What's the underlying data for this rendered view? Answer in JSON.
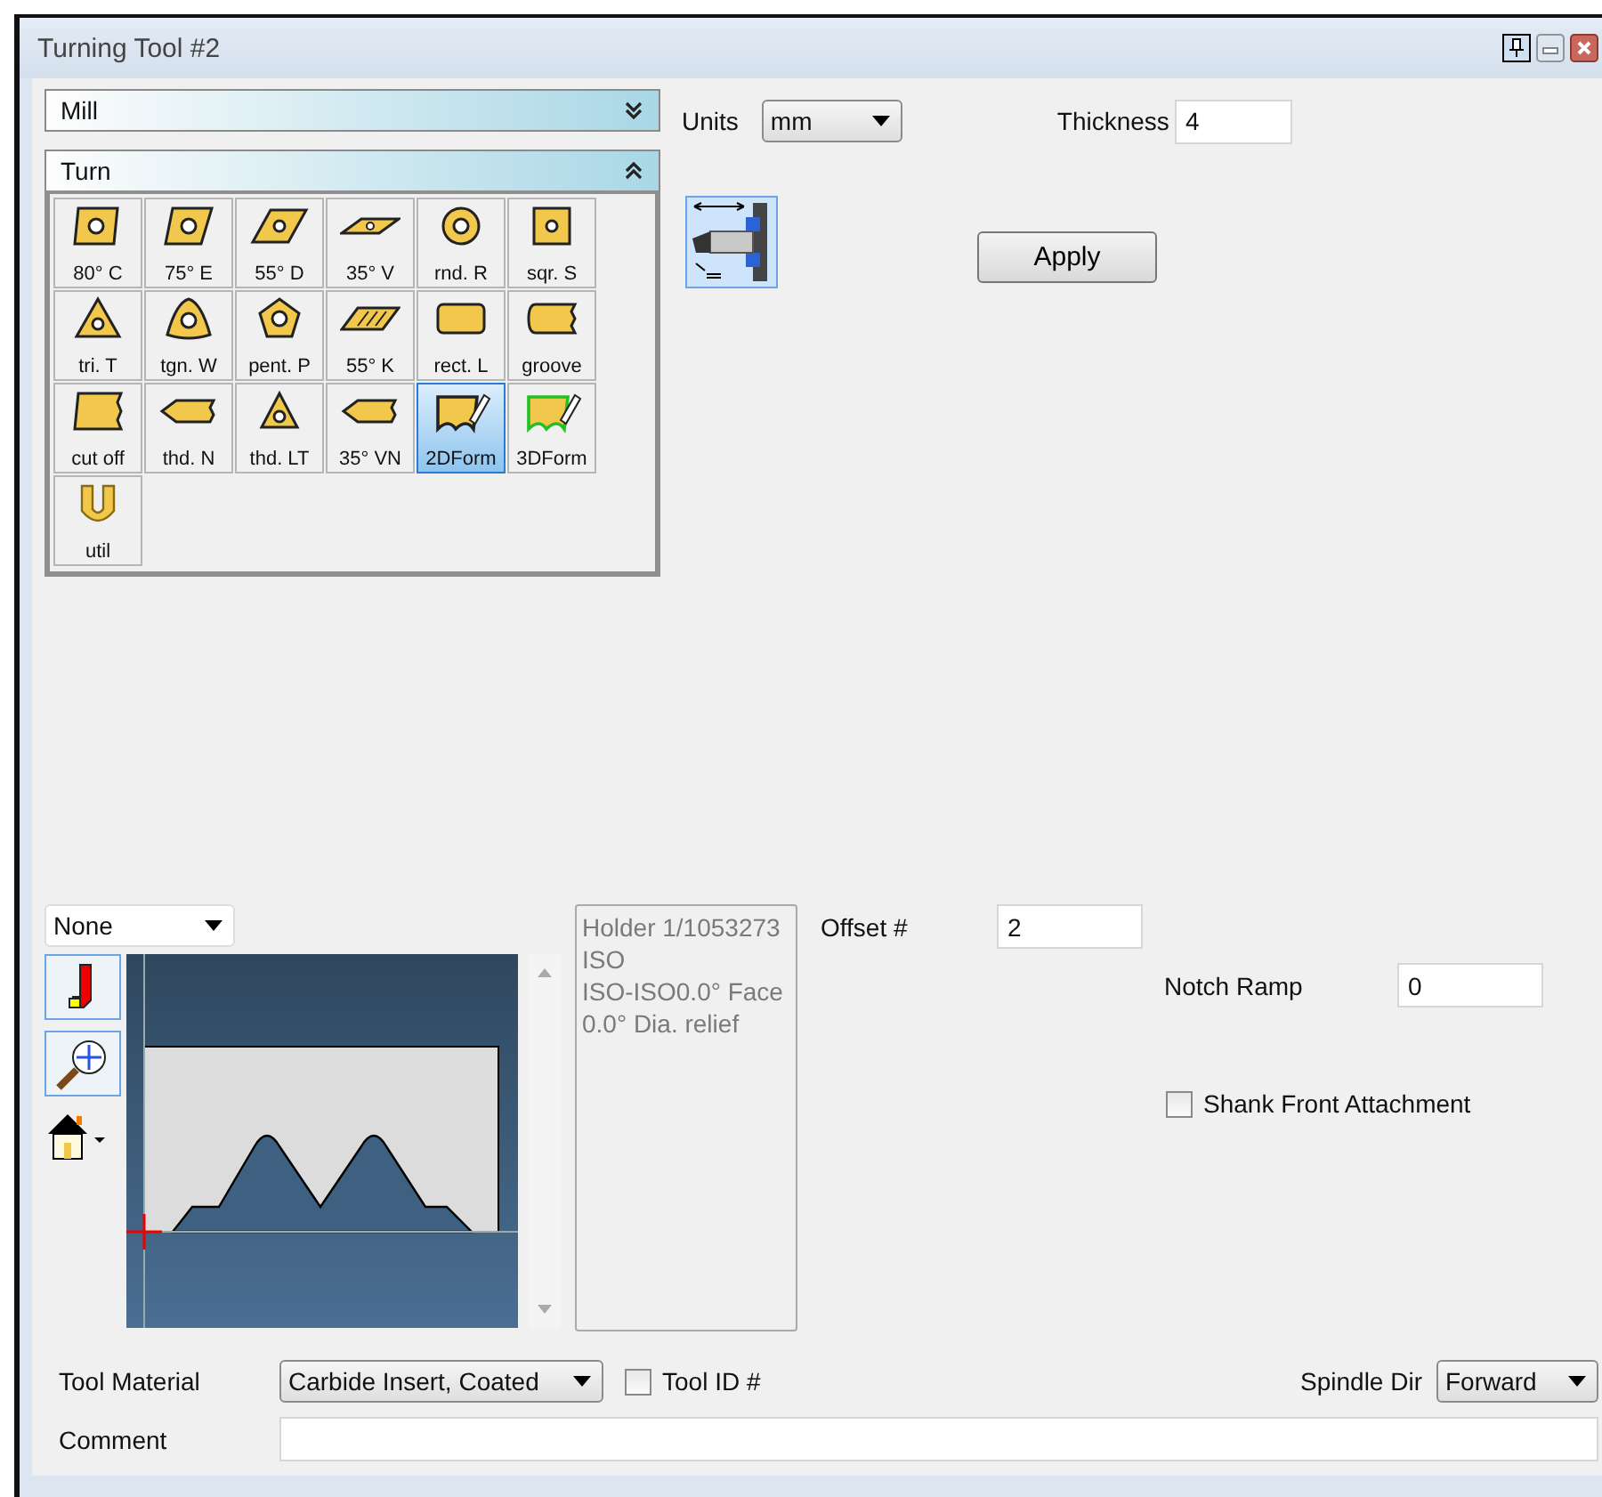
{
  "window": {
    "title": "Turning Tool #2"
  },
  "panels": [
    {
      "title": "Mill",
      "expanded": false
    },
    {
      "title": "Turn",
      "expanded": true
    }
  ],
  "tools": [
    {
      "label": "80° C",
      "kind": "diamond80",
      "selected": false
    },
    {
      "label": "75° E",
      "kind": "diamond75",
      "selected": false
    },
    {
      "label": "55° D",
      "kind": "diamond55",
      "selected": false
    },
    {
      "label": "35° V",
      "kind": "diamond35",
      "selected": false
    },
    {
      "label": "rnd. R",
      "kind": "round",
      "selected": false
    },
    {
      "label": "sqr. S",
      "kind": "square",
      "selected": false
    },
    {
      "label": "tri. T",
      "kind": "triangle",
      "selected": false
    },
    {
      "label": "tgn. W",
      "kind": "trigon",
      "selected": false
    },
    {
      "label": "pent. P",
      "kind": "pentagon",
      "selected": false
    },
    {
      "label": "55° K",
      "kind": "parallelogram",
      "selected": false
    },
    {
      "label": "rect. L",
      "kind": "rect",
      "selected": false
    },
    {
      "label": "groove",
      "kind": "groove",
      "selected": false
    },
    {
      "label": "cut off",
      "kind": "cutoff",
      "selected": false
    },
    {
      "label": "thd. N",
      "kind": "thread",
      "selected": false
    },
    {
      "label": "thd. LT",
      "kind": "threadlt",
      "selected": false
    },
    {
      "label": "35° VN",
      "kind": "thread",
      "selected": false
    },
    {
      "label": "2DForm",
      "kind": "form2d",
      "selected": true
    },
    {
      "label": "3DForm",
      "kind": "form3d",
      "selected": false
    },
    {
      "label": "util",
      "kind": "util",
      "selected": false
    }
  ],
  "units": {
    "label": "Units",
    "value": "mm"
  },
  "thickness": {
    "label": "Thickness",
    "value": "4"
  },
  "apply_button": "Apply",
  "view_select": {
    "value": "None"
  },
  "info_lines": [
    "Holder 1/1053273",
    "ISO",
    "ISO-ISO0.0° Face",
    "0.0° Dia. relief"
  ],
  "offset": {
    "label": "Offset #",
    "value": "2"
  },
  "notch_ramp": {
    "label": "Notch Ramp",
    "value": "0"
  },
  "shank_front_attachment": {
    "label": "Shank Front Attachment",
    "checked": false
  },
  "tool_material": {
    "label": "Tool Material",
    "value": "Carbide Insert, Coated"
  },
  "tool_id": {
    "label": "Tool ID #",
    "checked": false
  },
  "spindle_dir": {
    "label": "Spindle Dir",
    "value": "Forward"
  },
  "comment": {
    "label": "Comment"
  }
}
